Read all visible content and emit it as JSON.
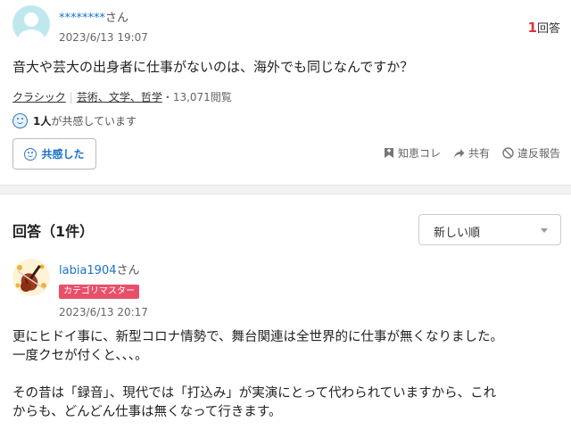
{
  "question": {
    "user": {
      "name": "********",
      "suffix": "さん"
    },
    "date": "2023/6/13 19:07",
    "answer_count": {
      "number": "1",
      "label": "回答"
    },
    "text": "音大や芸大の出身者に仕事がないのは、海外でも同じなんですか？",
    "tags": {
      "category1": "クラシック",
      "category2": "芸術、文学、哲学",
      "views": "・13,071閲覧"
    },
    "empathy": {
      "count": "1人",
      "text": "が共感しています"
    },
    "empathy_button": "共感した",
    "actions": {
      "chiebukuro": "知恵コレ",
      "share": "共有",
      "report": "違反報告"
    }
  },
  "answers_section": {
    "heading": "回答（1件）",
    "sort": {
      "selected": "新しい順"
    }
  },
  "answer": {
    "user": {
      "name": "labia1904",
      "suffix": "さん"
    },
    "badge": "カテゴリマスター",
    "date": "2023/6/13 20:17",
    "paragraphs": [
      "更にヒドイ事に、新型コロナ情勢で、舞台関連は全世界的に仕事が無くなりました。",
      "一度クセが付くと、、、。",
      "",
      "その昔は「録音」、現代では「打込み」が実演にとって代わられていますから、これ",
      "からも、どんどん仕事は無くなって行きます。"
    ]
  },
  "colors": {
    "link": "#1a73c8",
    "accent_red": "#e0333a",
    "badge": "#e8506a"
  }
}
